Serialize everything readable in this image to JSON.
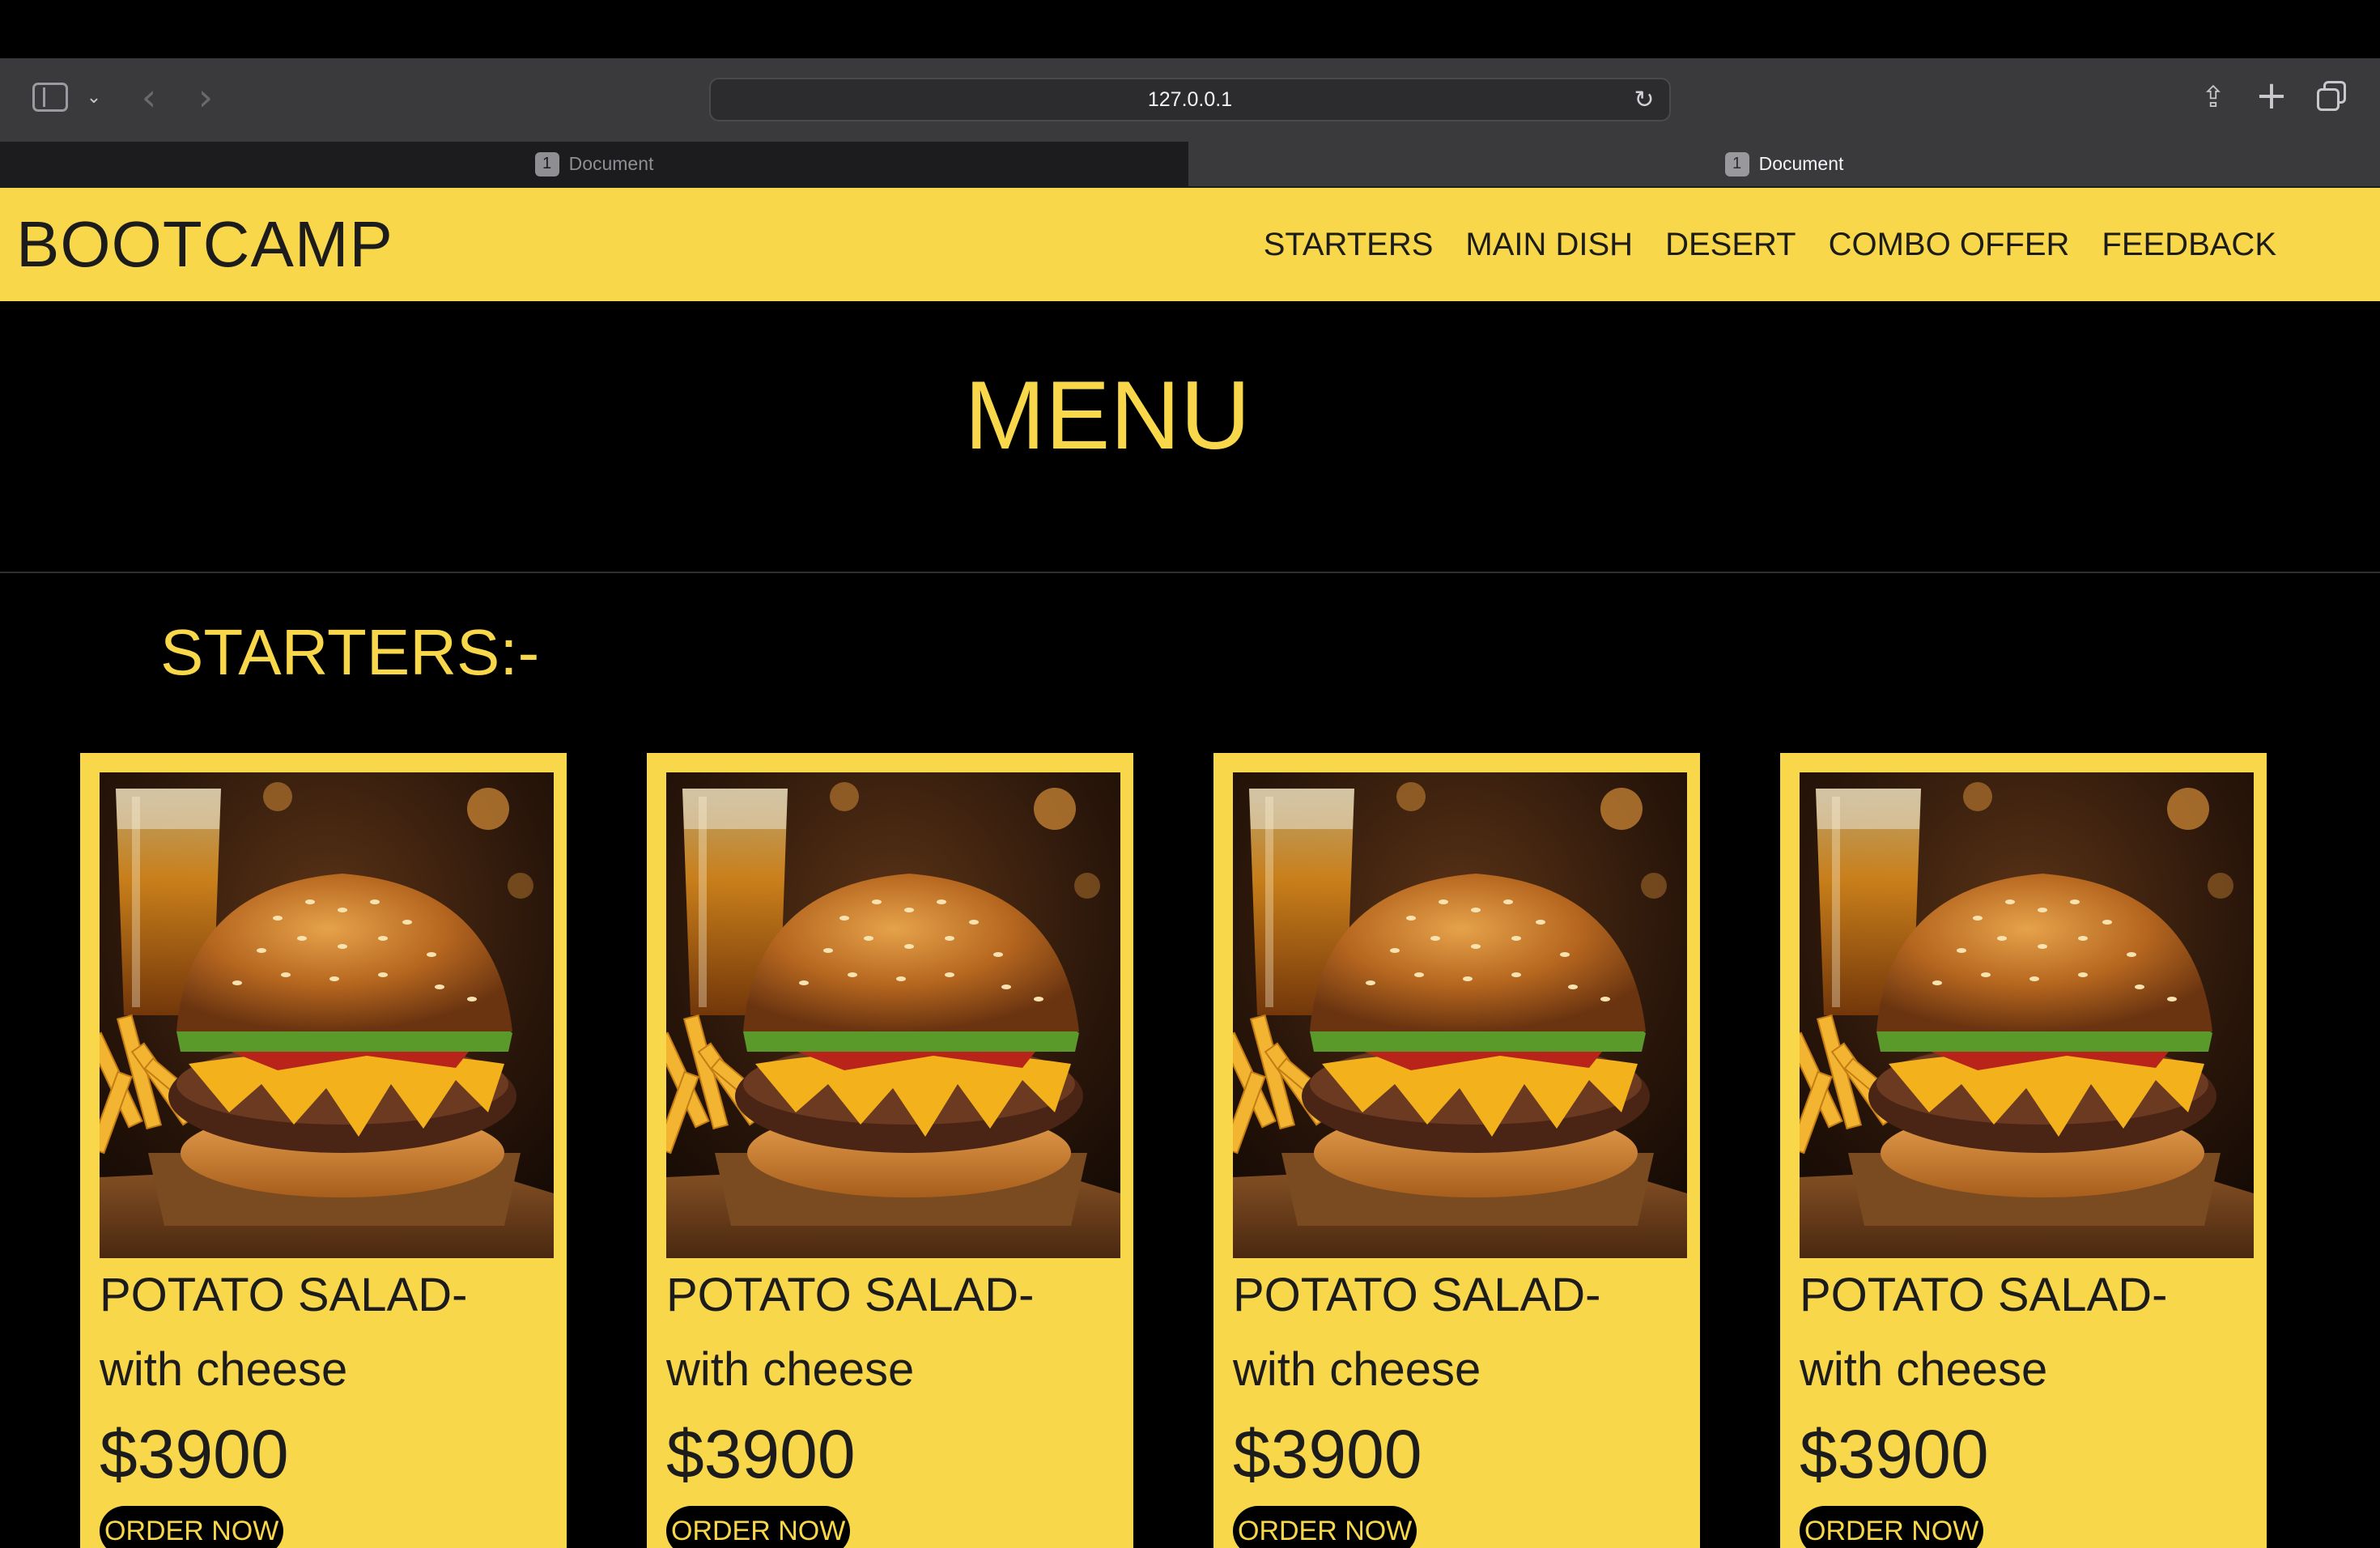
{
  "browser": {
    "url": "127.0.0.1",
    "tabs": [
      {
        "label": "Document",
        "badge": "1"
      },
      {
        "label": "Document",
        "badge": "1"
      }
    ]
  },
  "navbar": {
    "brand": "BOOTCAMP",
    "links": [
      "STARTERS",
      "MAIN DISH",
      "DESERT",
      "COMBO OFFER",
      "FEEDBACK"
    ]
  },
  "hero": {
    "title": "MENU"
  },
  "section": {
    "title": "STARTERS:-"
  },
  "cards": [
    {
      "name": "POTATO SALAD-",
      "desc": "with cheese",
      "price": "$3900",
      "button": "ORDER NOW"
    },
    {
      "name": "POTATO SALAD-",
      "desc": "with cheese",
      "price": "$3900",
      "button": "ORDER NOW"
    },
    {
      "name": "POTATO SALAD-",
      "desc": "with cheese",
      "price": "$3900",
      "button": "ORDER NOW"
    },
    {
      "name": "POTATO SALAD-",
      "desc": "with cheese",
      "price": "$3900",
      "button": "ORDER NOW"
    }
  ],
  "colors": {
    "accent": "#f9d74a",
    "background": "#000000",
    "text": "#1c1c1c"
  }
}
